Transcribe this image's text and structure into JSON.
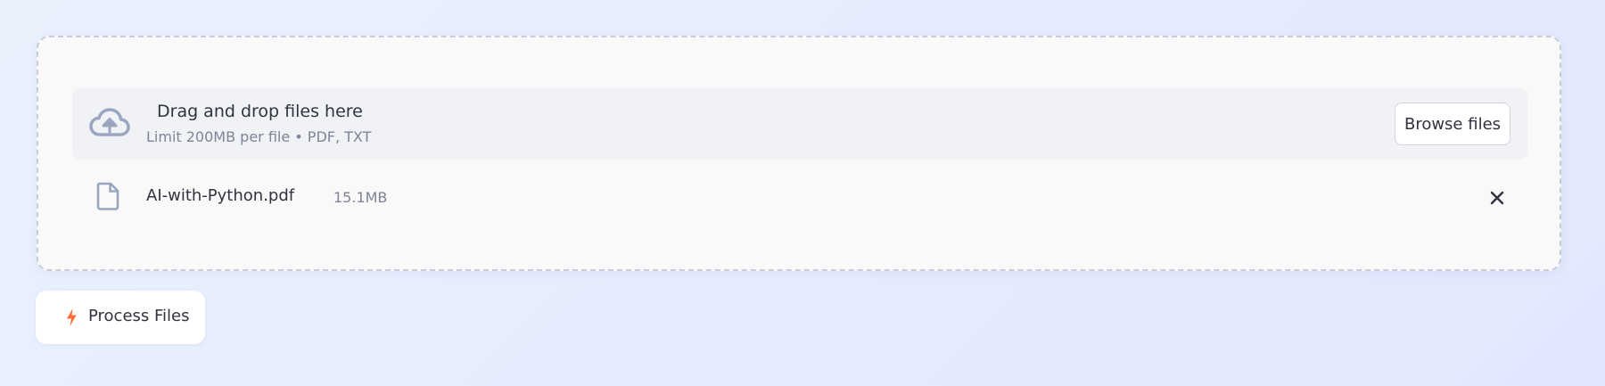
{
  "uploader": {
    "dropzone": {
      "title": "Drag and drop files here",
      "limit_text": "Limit 200MB per file • PDF, TXT",
      "icon": "cloud-upload-icon",
      "browse_label": "Browse files"
    },
    "files": [
      {
        "name": "AI-with-Python.pdf",
        "size": "15.1MB",
        "icon": "file-icon",
        "remove_icon": "close-icon"
      }
    ]
  },
  "actions": {
    "process_label": "Process Files",
    "process_icon": "lightning-icon"
  },
  "colors": {
    "icon_gray_blue": "#9aa6c0",
    "accent_orange": "#ff6b35",
    "text_primary": "#31333f",
    "text_muted": "#808495"
  }
}
